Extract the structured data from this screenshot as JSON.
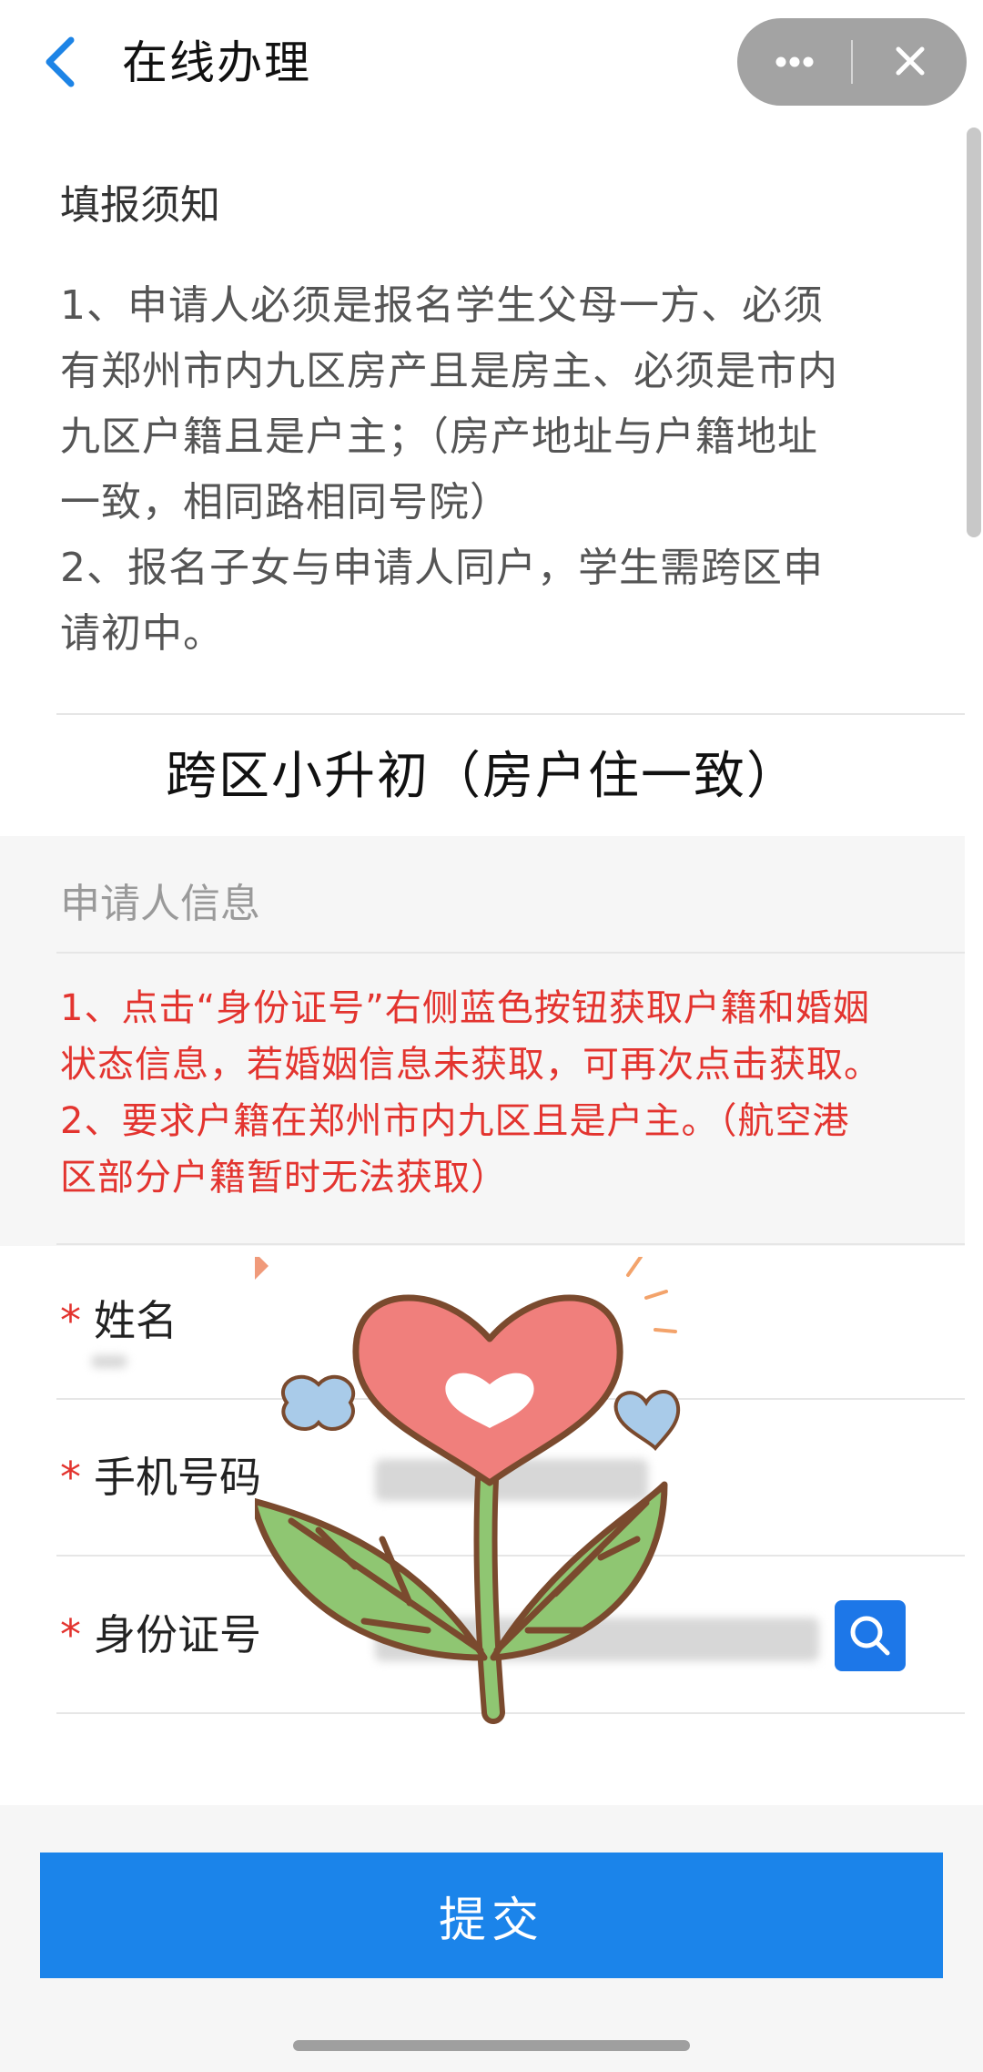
{
  "nav": {
    "title": "在线办理"
  },
  "notice": {
    "heading": "填报须知",
    "lines": [
      "1、申请人必须是报名学生父母一方、必须",
      "有郑州市内九区房产且是房主、必须是市内",
      "九区户籍且是户主；（房产地址与户籍地址",
      "一致，相同路相同号院）",
      "2、报名子女与申请人同户，学生需跨区申",
      "请初中。"
    ]
  },
  "form_title": "跨区小升初（房户住一致）",
  "applicant_section": {
    "label": "申请人信息",
    "tips": [
      "1、点击“身份证号”右侧蓝色按钮获取户籍和婚姻",
      "状态信息，若婚姻信息未获取，可再次点击获取。",
      "2、要求户籍在郑州市内九区且是户主。（航空港",
      "区部分户籍暂时无法获取）"
    ]
  },
  "fields": [
    {
      "label": "姓名",
      "required_mark": "*"
    },
    {
      "label": "手机号码",
      "required_mark": "*"
    },
    {
      "label": "身份证号",
      "required_mark": "*"
    }
  ],
  "submit_label": "提交",
  "colors": {
    "accent_blue": "#1b84ea",
    "warning_red": "#e3342f",
    "capsule_grey": "#a3a3a3"
  },
  "icons": [
    "back-chevron-icon",
    "more-dots-icon",
    "close-icon",
    "search-icon",
    "flower-sticker"
  ]
}
